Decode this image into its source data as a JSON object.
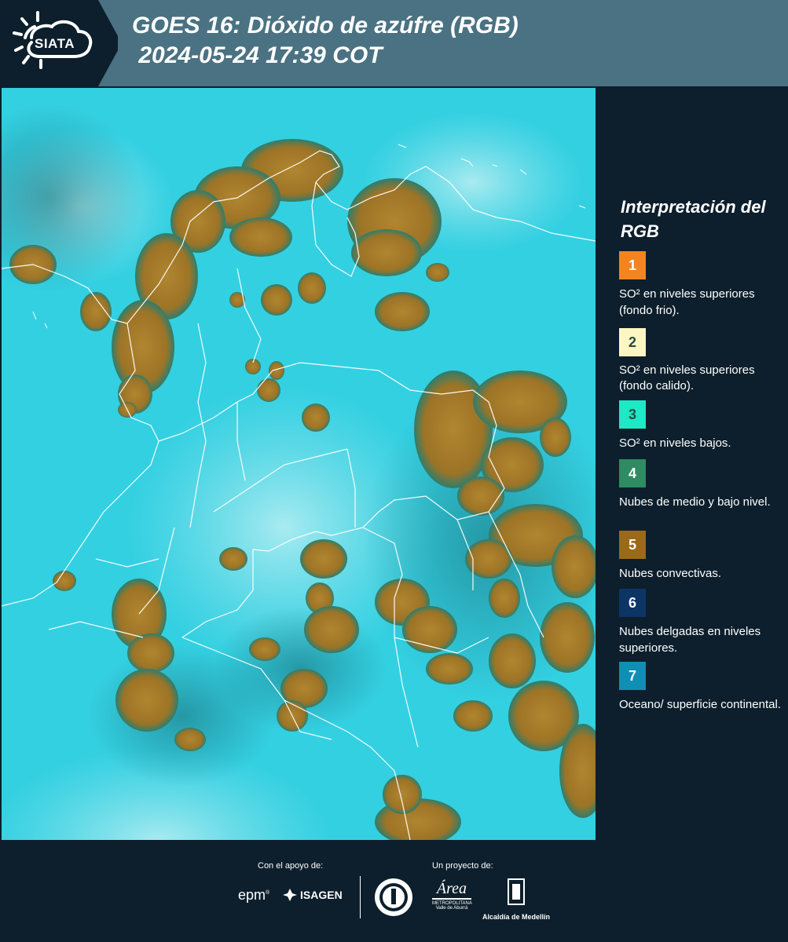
{
  "header": {
    "logo_text": "SIATA",
    "title_line1": "GOES 16: Dióxido de azúfre (RGB)",
    "title_line2": " 2024-05-24 17:39 COT"
  },
  "legend": {
    "title": "Interpretación del RGB",
    "items": [
      {
        "num": "1",
        "color": "#f5841f",
        "text": "SO² en niveles superiores (fondo frio)."
      },
      {
        "num": "2",
        "color": "#fdf6c3",
        "text": "SO² en niveles superiores (fondo calido)."
      },
      {
        "num": "3",
        "color": "#1de9c4",
        "text": "SO² en niveles bajos."
      },
      {
        "num": "4",
        "color": "#2e8b62",
        "text": "Nubes de medio y bajo nivel."
      },
      {
        "num": "5",
        "color": "#9a6a17",
        "text": "Nubes convectivas."
      },
      {
        "num": "6",
        "color": "#0c3566",
        "text": "Nubes delgadas en niveles superiores."
      },
      {
        "num": "7",
        "color": "#0e8fb3",
        "text": "Oceano/ superficie continental."
      }
    ]
  },
  "footer": {
    "support_label": "Con el apoyo de:",
    "project_label": "Un proyecto de:",
    "epm": "epm",
    "isagen": "ISAGEN",
    "area_logo": "Área",
    "area_sub": "METROPOLITANA",
    "area_sub2": "Valle de Aburrá",
    "alcaldia": "Alcaldía de Medellín"
  },
  "colors": {
    "header_bg": "#4a7282",
    "panel_bg": "#0d1f2c",
    "ocean": "#30cfe0",
    "cloud": "#a47a2a"
  }
}
